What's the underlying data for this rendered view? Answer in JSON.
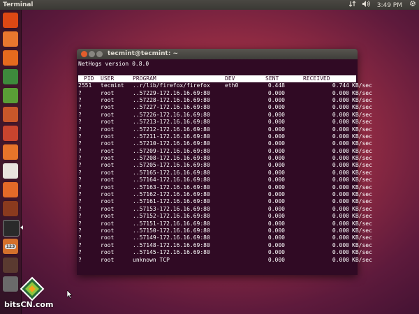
{
  "panel": {
    "app_title": "Terminal",
    "clock": "3:49 PM",
    "indicators": [
      "network-icon",
      "volume-icon",
      "settings-gear-icon"
    ]
  },
  "launcher": {
    "items": [
      {
        "name": "ubuntu-dash-icon",
        "color": "#dd4814"
      },
      {
        "name": "home-folder-icon",
        "color": "#e8772e"
      },
      {
        "name": "firefox-icon",
        "color": "#e66a1e"
      },
      {
        "name": "libreoffice-writer-icon",
        "color": "#3e8a3c"
      },
      {
        "name": "libreoffice-calc-icon",
        "color": "#5a9e36"
      },
      {
        "name": "libreoffice-impress-icon",
        "color": "#c9572a"
      },
      {
        "name": "software-center-icon",
        "color": "#c8442e"
      },
      {
        "name": "ubuntu-one-icon",
        "color": "#e7742a"
      },
      {
        "name": "amazon-icon",
        "color": "#e8e4de"
      },
      {
        "name": "ubuntu-one-music-icon",
        "color": "#e46a28"
      },
      {
        "name": "system-settings-icon",
        "color": "#8a3a1e"
      },
      {
        "name": "terminal-icon",
        "color": "#2a2a2a"
      },
      {
        "name": "workspace-switcher-icon",
        "color": "#d4702c"
      },
      {
        "name": "workspaces-icon",
        "color": "#5a3a30"
      },
      {
        "name": "trash-icon",
        "color": "#6a6a6a"
      }
    ],
    "workspace_badge": "123"
  },
  "window": {
    "title": "tecmint@tecmint: ~"
  },
  "nethogs": {
    "version_line": "NetHogs version 0.8.0",
    "headers": {
      "pid": "PID",
      "user": "USER",
      "program": "PROGRAM",
      "dev": "DEV",
      "sent": "SENT",
      "received": "RECEIVED"
    },
    "rows": [
      {
        "pid": "2551",
        "user": "tecmint",
        "program": "..r/lib/firefox/firefox",
        "dev": "eth0",
        "sent": "0.448",
        "received": "0.744",
        "unit": "KB/sec"
      },
      {
        "pid": "?",
        "user": "root",
        "program": "..57229-172.16.16.69:80",
        "dev": "",
        "sent": "0.000",
        "received": "0.000",
        "unit": "KB/sec"
      },
      {
        "pid": "?",
        "user": "root",
        "program": "..57228-172.16.16.69:80",
        "dev": "",
        "sent": "0.000",
        "received": "0.000",
        "unit": "KB/sec"
      },
      {
        "pid": "?",
        "user": "root",
        "program": "..57227-172.16.16.69:80",
        "dev": "",
        "sent": "0.000",
        "received": "0.000",
        "unit": "KB/sec"
      },
      {
        "pid": "?",
        "user": "root",
        "program": "..57226-172.16.16.69:80",
        "dev": "",
        "sent": "0.000",
        "received": "0.000",
        "unit": "KB/sec"
      },
      {
        "pid": "?",
        "user": "root",
        "program": "..57213-172.16.16.69:80",
        "dev": "",
        "sent": "0.000",
        "received": "0.000",
        "unit": "KB/sec"
      },
      {
        "pid": "?",
        "user": "root",
        "program": "..57212-172.16.16.69:80",
        "dev": "",
        "sent": "0.000",
        "received": "0.000",
        "unit": "KB/sec"
      },
      {
        "pid": "?",
        "user": "root",
        "program": "..57211-172.16.16.69:80",
        "dev": "",
        "sent": "0.000",
        "received": "0.000",
        "unit": "KB/sec"
      },
      {
        "pid": "?",
        "user": "root",
        "program": "..57210-172.16.16.69:80",
        "dev": "",
        "sent": "0.000",
        "received": "0.000",
        "unit": "KB/sec"
      },
      {
        "pid": "?",
        "user": "root",
        "program": "..57209-172.16.16.69:80",
        "dev": "",
        "sent": "0.000",
        "received": "0.000",
        "unit": "KB/sec"
      },
      {
        "pid": "?",
        "user": "root",
        "program": "..57208-172.16.16.69:80",
        "dev": "",
        "sent": "0.000",
        "received": "0.000",
        "unit": "KB/sec"
      },
      {
        "pid": "?",
        "user": "root",
        "program": "..57205-172.16.16.69:80",
        "dev": "",
        "sent": "0.000",
        "received": "0.000",
        "unit": "KB/sec"
      },
      {
        "pid": "?",
        "user": "root",
        "program": "..57165-172.16.16.69:80",
        "dev": "",
        "sent": "0.000",
        "received": "0.000",
        "unit": "KB/sec"
      },
      {
        "pid": "?",
        "user": "root",
        "program": "..57164-172.16.16.69:80",
        "dev": "",
        "sent": "0.000",
        "received": "0.000",
        "unit": "KB/sec"
      },
      {
        "pid": "?",
        "user": "root",
        "program": "..57163-172.16.16.69:80",
        "dev": "",
        "sent": "0.000",
        "received": "0.000",
        "unit": "KB/sec"
      },
      {
        "pid": "?",
        "user": "root",
        "program": "..57162-172.16.16.69:80",
        "dev": "",
        "sent": "0.000",
        "received": "0.000",
        "unit": "KB/sec"
      },
      {
        "pid": "?",
        "user": "root",
        "program": "..57161-172.16.16.69:80",
        "dev": "",
        "sent": "0.000",
        "received": "0.000",
        "unit": "KB/sec"
      },
      {
        "pid": "?",
        "user": "root",
        "program": "..57153-172.16.16.69:80",
        "dev": "",
        "sent": "0.000",
        "received": "0.000",
        "unit": "KB/sec"
      },
      {
        "pid": "?",
        "user": "root",
        "program": "..57152-172.16.16.69:80",
        "dev": "",
        "sent": "0.000",
        "received": "0.000",
        "unit": "KB/sec"
      },
      {
        "pid": "?",
        "user": "root",
        "program": "..57151-172.16.16.69:80",
        "dev": "",
        "sent": "0.000",
        "received": "0.000",
        "unit": "KB/sec"
      },
      {
        "pid": "?",
        "user": "root",
        "program": "..57150-172.16.16.69:80",
        "dev": "",
        "sent": "0.000",
        "received": "0.000",
        "unit": "KB/sec"
      },
      {
        "pid": "?",
        "user": "root",
        "program": "..57149-172.16.16.69:80",
        "dev": "",
        "sent": "0.000",
        "received": "0.000",
        "unit": "KB/sec"
      },
      {
        "pid": "?",
        "user": "root",
        "program": "..57148-172.16.16.69:80",
        "dev": "",
        "sent": "0.000",
        "received": "0.000",
        "unit": "KB/sec"
      },
      {
        "pid": "?",
        "user": "root",
        "program": "..57145-172.16.16.69:80",
        "dev": "",
        "sent": "0.000",
        "received": "0.000",
        "unit": "KB/sec"
      },
      {
        "pid": "?",
        "user": "root",
        "program": "unknown TCP",
        "dev": "",
        "sent": "0.000",
        "received": "0.000",
        "unit": "KB/sec"
      }
    ]
  },
  "watermark": {
    "text": "bitsCN.com"
  },
  "colors": {
    "terminal_bg": "#300a24",
    "terminal_fg": "#ffffff",
    "close_button": "#e35d2c"
  }
}
